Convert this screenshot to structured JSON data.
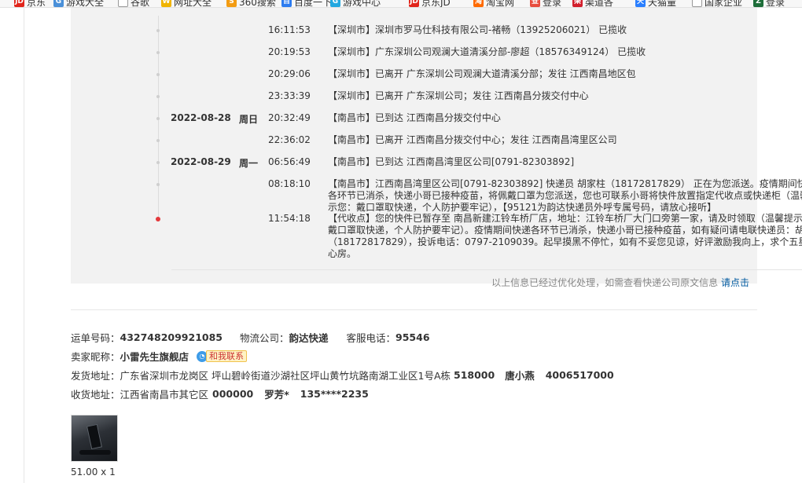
{
  "bookmarks": [
    {
      "label": "京东",
      "icon": "jd-icon",
      "color": "#e1251b",
      "glyph": "JD"
    },
    {
      "label": "游戏大全",
      "icon": "game-icon",
      "color": "#4a90d9",
      "glyph": "G"
    },
    {
      "label": "谷歌",
      "icon": "page-icon",
      "color": "#ffffff",
      "glyph": ""
    },
    {
      "label": "网址大全",
      "icon": "web-icon",
      "color": "#f0b400",
      "glyph": "W"
    },
    {
      "label": "360搜索",
      "icon": "search360-icon",
      "color": "#f39c12",
      "glyph": "S"
    },
    {
      "label": "百度一下",
      "icon": "baidu-icon",
      "color": "#2d7cf0",
      "glyph": "百"
    },
    {
      "label": "游戏中心",
      "icon": "gamecenter-icon",
      "color": "#23a8e0",
      "glyph": "G"
    },
    {
      "label": "京东JD",
      "icon": "jd2-icon",
      "color": "#e1251b",
      "glyph": "JD"
    },
    {
      "label": "淘宝网",
      "icon": "taobao-icon",
      "color": "#ff6a00",
      "glyph": "淘"
    },
    {
      "label": "登录",
      "icon": "login-icon",
      "color": "#e84c3d",
      "glyph": "登"
    },
    {
      "label": "渠道各",
      "icon": "channel-icon",
      "color": "#d21e2b",
      "glyph": "渠"
    },
    {
      "label": "天猫量",
      "icon": "tmall-icon",
      "color": "#2a7fff",
      "glyph": "天"
    },
    {
      "label": "国家企业",
      "icon": "page2-icon",
      "color": "#ffffff",
      "glyph": ""
    },
    {
      "label": "登录",
      "icon": "z-icon",
      "color": "#1e6e3a",
      "glyph": "Z"
    }
  ],
  "tracking": {
    "events": [
      {
        "date": "",
        "week": "",
        "time": "16:11:53",
        "desc": "【深圳市】深圳市罗马仕科技有限公司-褚畅（13925206021） 已揽收"
      },
      {
        "date": "",
        "week": "",
        "time": "20:19:53",
        "desc": "【深圳市】广东深圳公司观澜大道清溪分部-廖超（18576349124） 已揽收"
      },
      {
        "date": "",
        "week": "",
        "time": "20:29:06",
        "desc": "【深圳市】已离开 广东深圳公司观澜大道清溪分部；发往 江西南昌地区包"
      },
      {
        "date": "",
        "week": "",
        "time": "23:33:39",
        "desc": "【深圳市】已离开 广东深圳公司；发往 江西南昌分拨交付中心"
      },
      {
        "date": "2022-08-28",
        "week": "周日",
        "time": "20:32:49",
        "desc": "【南昌市】已到达 江西南昌分拨交付中心"
      },
      {
        "date": "",
        "week": "",
        "time": "22:36:02",
        "desc": "【南昌市】已离开 江西南昌分拨交付中心；发往 江西南昌湾里区公司"
      },
      {
        "date": "2022-08-29",
        "week": "周一",
        "time": "06:56:49",
        "desc": "【南昌市】已到达 江西南昌湾里区公司[0791-82303892]"
      },
      {
        "date": "",
        "week": "",
        "time": "08:18:10",
        "desc": "【南昌市】江西南昌湾里区公司[0791-82303892] 快递员 胡家柱（18172817829） 正在为您派送。疫情期间快递各环节已消杀，快递小哥已接种疫苗，将佩戴口罩为您派送，您也可联系小哥将快件放置指定代收点或快递柜（温馨提示您：戴口罩取快递，个人防护要牢记），【95121为韵达快递员外呼专属号码，请放心接听】"
      },
      {
        "date": "",
        "week": "",
        "time": "11:54:18",
        "desc": "【代收点】您的快件已暂存至 南昌新建江铃车桥厂店，地址：江铃车桥厂大门口旁第一家，请及时领取（温馨提示您：戴口罩取快递，个人防护要牢记）。疫情期间快递各环节已消杀，快递小哥已接种疫苗，如有疑问请电联快递员：胡家柱（18172817829），投诉电话：0797-2109039。起早摸黑不停忙，如有不妥您见谅，好评激励我向上，求个五星暖心房。"
      }
    ],
    "note": "以上信息已经过优化处理，如需查看快递公司原文信息",
    "note_link": "请点击"
  },
  "info": {
    "waybill_label": "运单号码：",
    "waybill": "432748209921085",
    "carrier_label": "物流公司：",
    "carrier": "韵达快递",
    "phone_label": "客服电话：",
    "phone": "95546",
    "seller_label": "卖家昵称：",
    "seller": "小雷先生旗舰店",
    "contact_label": "和我联系",
    "ship_from_label": "发货地址：",
    "ship_from": "广东省深圳市龙岗区 坪山碧岭街道沙湖社区坪山黄竹坑路南湖工业区1号A栋",
    "ship_from_zip": "518000",
    "ship_from_name": "唐小燕",
    "ship_from_phone": "4006517000",
    "ship_to_label": "收货地址：",
    "ship_to": "江西省南昌市其它区",
    "ship_to_zip": "000000",
    "ship_to_name": "罗芳*",
    "ship_to_phone": "135****2235"
  },
  "product": {
    "qty_text": "51.00 x 1"
  }
}
